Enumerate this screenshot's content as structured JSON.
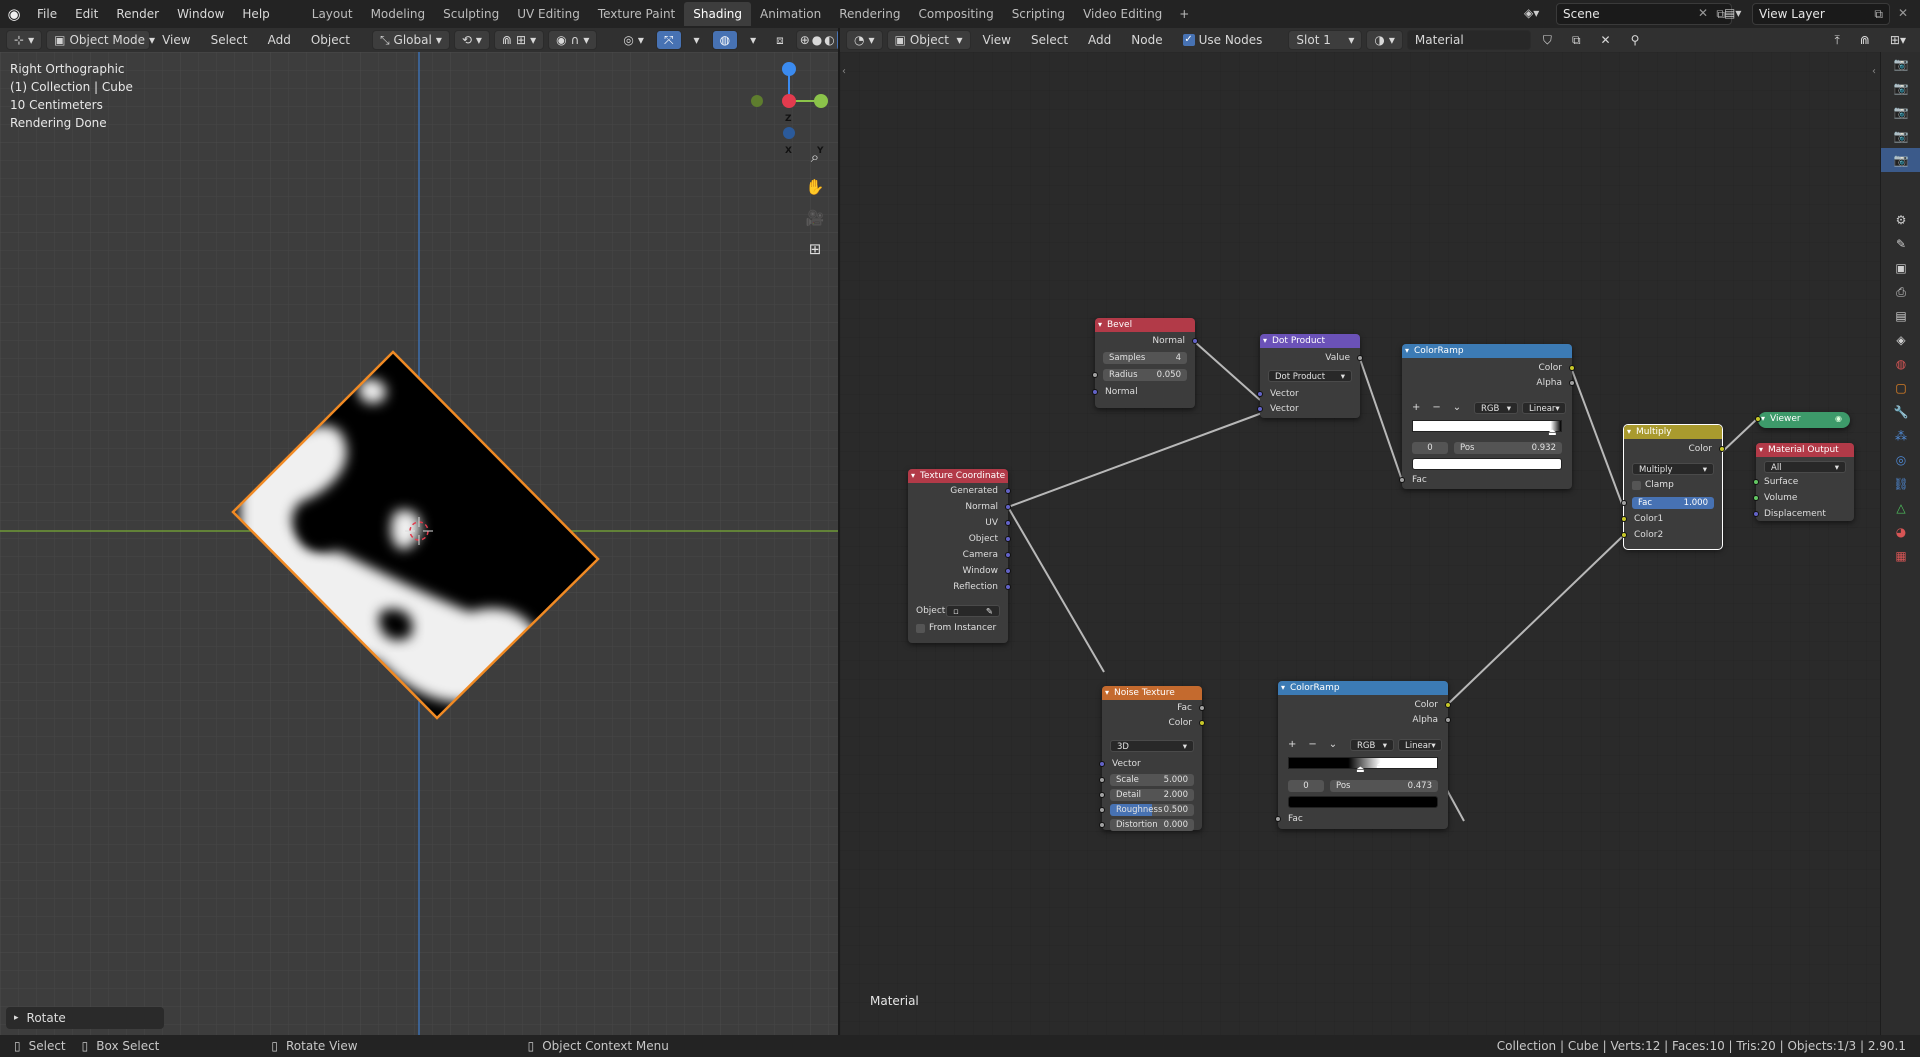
{
  "app": {
    "menu": [
      "File",
      "Edit",
      "Render",
      "Window",
      "Help"
    ],
    "workspaces": [
      "Layout",
      "Modeling",
      "Sculpting",
      "UV Editing",
      "Texture Paint",
      "Shading",
      "Animation",
      "Rendering",
      "Compositing",
      "Scripting",
      "Video Editing"
    ],
    "active_workspace": "Shading",
    "scene_name": "Scene",
    "view_layer": "View Layer"
  },
  "viewport_header": {
    "mode": "Object Mode",
    "menu": [
      "View",
      "Select",
      "Add",
      "Object"
    ],
    "orientation": "Global"
  },
  "viewport": {
    "view_name": "Right Orthographic",
    "collection": "(1) Collection | Cube",
    "scale": "10 Centimeters",
    "status": "Rendering Done",
    "last_operator": "Rotate",
    "gizmo": {
      "z": "Z",
      "x": "X",
      "y": "Y"
    }
  },
  "node_header": {
    "type": "Object",
    "menu": [
      "View",
      "Select",
      "Add",
      "Node"
    ],
    "use_nodes_label": "Use Nodes",
    "use_nodes_checked": true,
    "slot": "Slot 1",
    "material": "Material"
  },
  "node_editor": {
    "material_label": "Material"
  },
  "nodes": {
    "bevel": {
      "title": "Bevel",
      "out_normal": "Normal",
      "samples_label": "Samples",
      "samples_value": "4",
      "radius_label": "Radius",
      "radius_value": "0.050",
      "in_normal": "Normal"
    },
    "dot": {
      "title": "Dot Product",
      "out_value": "Value",
      "op": "Dot Product",
      "in1": "Vector",
      "in2": "Vector"
    },
    "ramp1": {
      "title": "ColorRamp",
      "out_color": "Color",
      "out_alpha": "Alpha",
      "mode": "RGB",
      "interp": "Linear",
      "stop_index": "0",
      "pos_label": "Pos",
      "pos_value": "0.932",
      "in_fac": "Fac"
    },
    "texcoord": {
      "title": "Texture Coordinate",
      "outputs": [
        "Generated",
        "Normal",
        "UV",
        "Object",
        "Camera",
        "Window",
        "Reflection"
      ],
      "object_label": "Object:",
      "from_instancer": "From Instancer"
    },
    "noise": {
      "title": "Noise Texture",
      "out_fac": "Fac",
      "out_color": "Color",
      "dims": "3D",
      "in_vector": "Vector",
      "scale_label": "Scale",
      "scale_value": "5.000",
      "detail_label": "Detail",
      "detail_value": "2.000",
      "rough_label": "Roughness",
      "rough_value": "0.500",
      "dist_label": "Distortion",
      "dist_value": "0.000"
    },
    "ramp2": {
      "title": "ColorRamp",
      "out_color": "Color",
      "out_alpha": "Alpha",
      "mode": "RGB",
      "interp": "Linear",
      "stop_index": "0",
      "pos_label": "Pos",
      "pos_value": "0.473",
      "in_fac": "Fac"
    },
    "multiply": {
      "title": "Multiply",
      "out_color": "Color",
      "op": "Multiply",
      "clamp": "Clamp",
      "fac_label": "Fac",
      "fac_value": "1.000",
      "in1": "Color1",
      "in2": "Color2"
    },
    "viewer": {
      "title": "Viewer"
    },
    "output": {
      "title": "Material Output",
      "target": "All",
      "in_surface": "Surface",
      "in_volume": "Volume",
      "in_disp": "Displacement"
    }
  },
  "statusbar": {
    "select": "Select",
    "box_select": "Box Select",
    "rotate_view": "Rotate View",
    "context_menu": "Object Context Menu",
    "stats": "Collection | Cube | Verts:12 | Faces:10 | Tris:20 | Objects:1/3 | 2.90.1"
  },
  "colors": {
    "accent": "#4772b3",
    "selection_outline": "#f08a24",
    "x_axis": "#e33b4e",
    "y_axis": "#8bc34a",
    "z_axis": "#3b8bf0"
  }
}
